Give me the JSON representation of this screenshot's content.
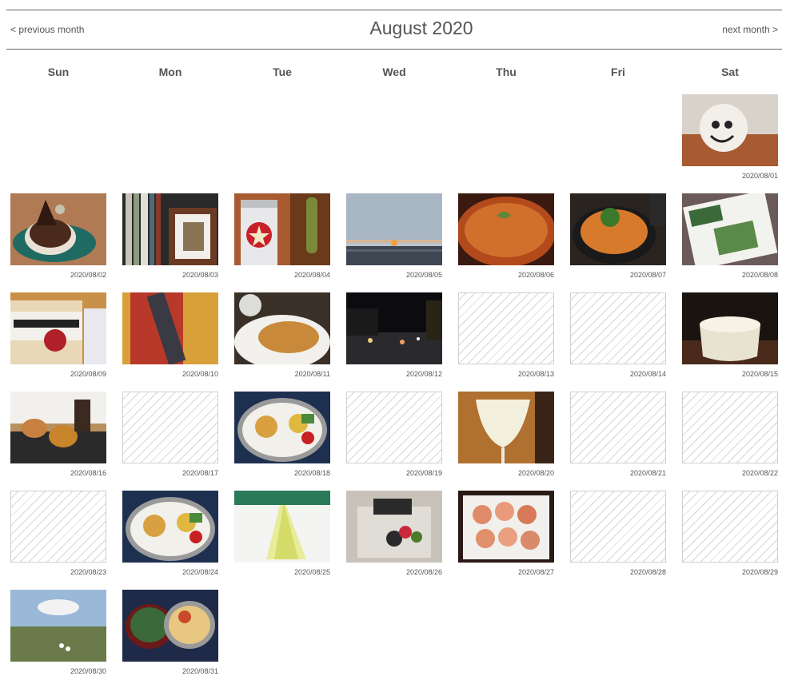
{
  "header": {
    "title": "August 2020",
    "prev_label": "< previous month",
    "next_label": "next month >"
  },
  "weekdays": [
    "Sun",
    "Mon",
    "Tue",
    "Wed",
    "Thu",
    "Fri",
    "Sat"
  ],
  "days": [
    {
      "date": "2020/08/01",
      "photo": "plush-toy"
    },
    {
      "date": "2020/08/02",
      "photo": "chocolate-cake"
    },
    {
      "date": "2020/08/03",
      "photo": "bookshelf"
    },
    {
      "date": "2020/08/04",
      "photo": "beer-can"
    },
    {
      "date": "2020/08/05",
      "photo": "sunset"
    },
    {
      "date": "2020/08/06",
      "photo": "curry"
    },
    {
      "date": "2020/08/07",
      "photo": "soup-bowl"
    },
    {
      "date": "2020/08/08",
      "photo": "magazine"
    },
    {
      "date": "2020/08/09",
      "photo": "whiskey-glass"
    },
    {
      "date": "2020/08/10",
      "photo": "book"
    },
    {
      "date": "2020/08/11",
      "photo": "fried-cutlet"
    },
    {
      "date": "2020/08/12",
      "photo": "night-street"
    },
    {
      "date": "2020/08/13",
      "photo": null
    },
    {
      "date": "2020/08/14",
      "photo": null
    },
    {
      "date": "2020/08/15",
      "photo": "pudding"
    },
    {
      "date": "2020/08/16",
      "photo": "burgers"
    },
    {
      "date": "2020/08/17",
      "photo": null
    },
    {
      "date": "2020/08/18",
      "photo": "bento"
    },
    {
      "date": "2020/08/19",
      "photo": null
    },
    {
      "date": "2020/08/20",
      "photo": "wine-glass"
    },
    {
      "date": "2020/08/21",
      "photo": null
    },
    {
      "date": "2020/08/22",
      "photo": null
    },
    {
      "date": "2020/08/23",
      "photo": null
    },
    {
      "date": "2020/08/24",
      "photo": "bento"
    },
    {
      "date": "2020/08/25",
      "photo": "cake-slice"
    },
    {
      "date": "2020/08/26",
      "photo": "cake-box"
    },
    {
      "date": "2020/08/27",
      "photo": "peaches"
    },
    {
      "date": "2020/08/28",
      "photo": null
    },
    {
      "date": "2020/08/29",
      "photo": null
    },
    {
      "date": "2020/08/30",
      "photo": "garden-sky"
    },
    {
      "date": "2020/08/31",
      "photo": "bento-soup"
    }
  ]
}
